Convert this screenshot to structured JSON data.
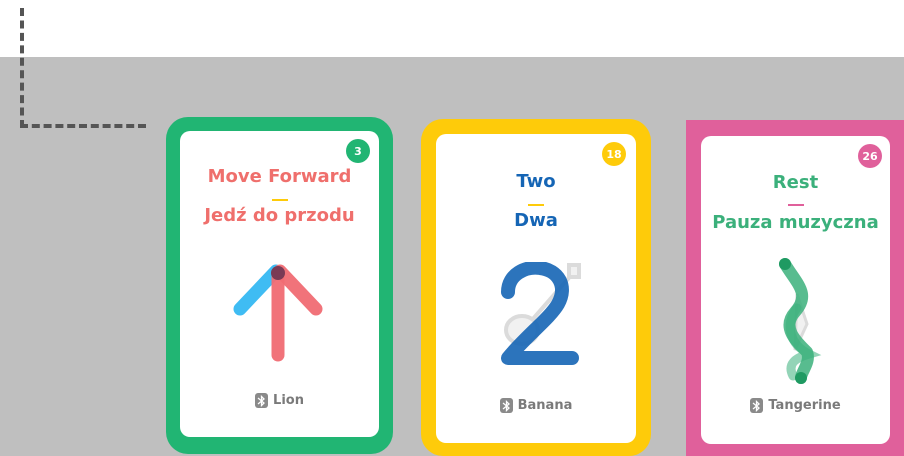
{
  "cards": [
    {
      "number": "3",
      "title_en": "Move Forward",
      "title_pl": "Jedź do przodu",
      "footer": "Lion",
      "frame_color": "#21b573",
      "text_color": "#ef6f6c",
      "art_icon": "arrow-up-icon"
    },
    {
      "number": "18",
      "title_en": "Two",
      "title_pl": "Dwa",
      "footer": "Banana",
      "frame_color": "#fecb0a",
      "text_color": "#1565b5",
      "art_icon": "number-two-icon"
    },
    {
      "number": "26",
      "title_en": "Rest",
      "title_pl": "Pauza muzyczna",
      "footer": "Tangerine",
      "frame_color": "#e0609b",
      "text_color": "#3bb07b",
      "art_icon": "quarter-rest-icon"
    }
  ],
  "icons": {
    "footer": "bluetooth-icon"
  }
}
